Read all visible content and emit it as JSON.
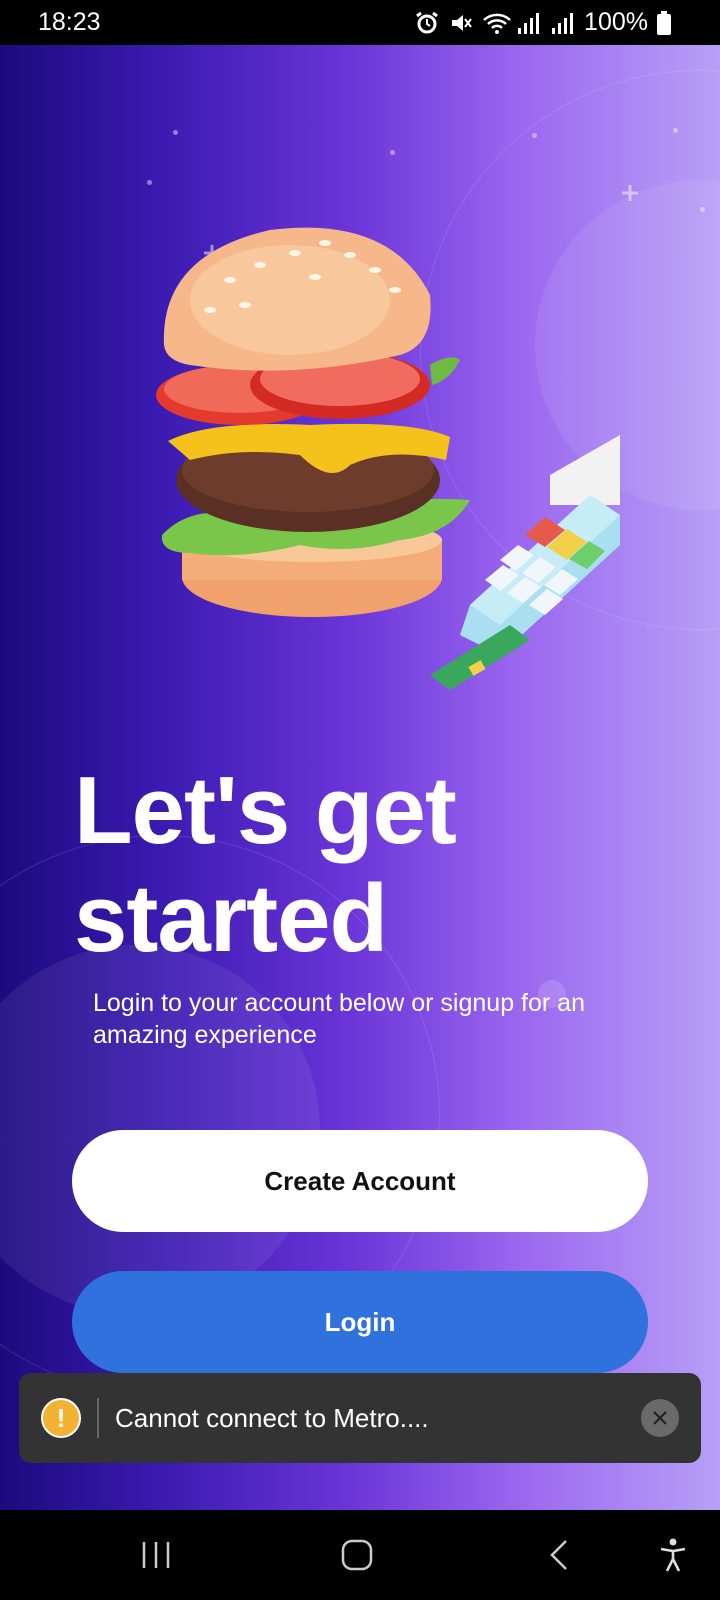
{
  "status_bar": {
    "time": "18:23",
    "icons": [
      "alarm-icon",
      "mute-icon",
      "wifi-icon",
      "signal-icon",
      "signal-icon"
    ],
    "battery": "100%"
  },
  "hero": {
    "illustration": [
      "burger-illustration",
      "card-terminal-illustration"
    ]
  },
  "onboarding": {
    "headline_line1": "Let's get",
    "headline_line2": "started",
    "subtitle": "Login to your account below or signup for an amazing experience"
  },
  "actions": {
    "create_account_label": "Create Account",
    "login_label": "Login"
  },
  "toast": {
    "icon": "warning-icon",
    "message": "Cannot connect to Metro....",
    "close_icon": "close-icon"
  },
  "nav_bar": {
    "items": [
      "recent-apps-icon",
      "home-icon",
      "back-icon",
      "accessibility-icon"
    ]
  },
  "colors": {
    "gradient_start": "#1c0a7e",
    "gradient_end": "#b7a0f7",
    "login_button": "#2f72dd",
    "toast_bg": "#333333",
    "warning": "#f2b233"
  }
}
